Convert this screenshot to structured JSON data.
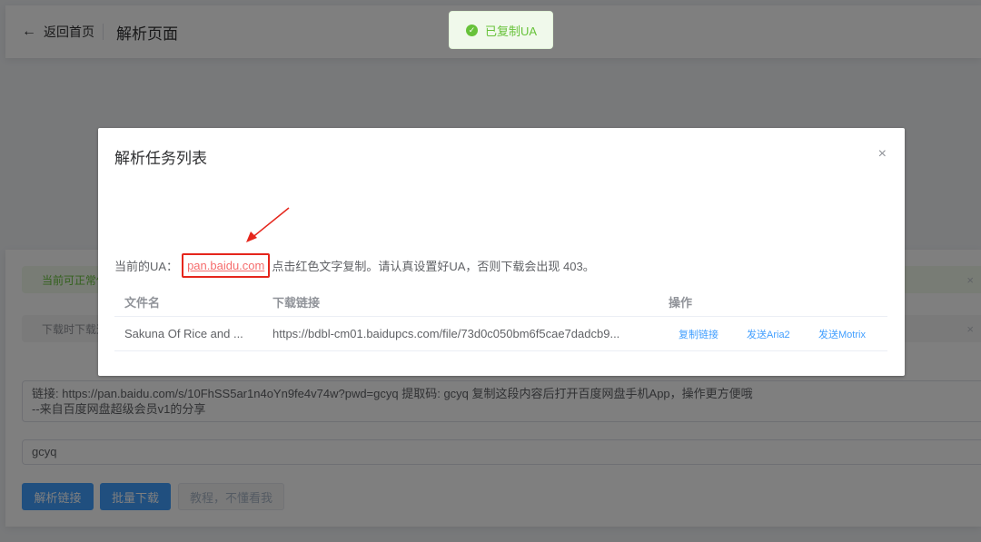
{
  "header": {
    "back_label": "返回首页",
    "title": "解析页面"
  },
  "alerts": {
    "success_text": "当前可正常使用",
    "info_text": "下载时下载速度",
    "close_glyph": "×"
  },
  "form": {
    "share_text": "链接: https://pan.baidu.com/s/10FhSS5ar1n4oYn9fe4v74w?pwd=gcyq 提取码: gcyq 复制这段内容后打开百度网盘手机App，操作更方便哦\n--来自百度网盘超级会员v1的分享",
    "code_value": "gcyq",
    "buttons": {
      "parse": "解析链接",
      "batch": "批量下载",
      "tutorial": "教程，不懂看我"
    }
  },
  "toast": {
    "text": "已复制UA",
    "icon": "check-circle-icon"
  },
  "dialog": {
    "title": "解析任务列表",
    "close_glyph": "×",
    "ua_prefix": "当前的UA：",
    "ua_value": "pan.baidu.com",
    "ua_suffix": "点击红色文字复制。请认真设置好UA，否则下载会出现 403。",
    "table": {
      "headers": [
        "文件名",
        "下载链接",
        "操作"
      ],
      "rows": [
        {
          "filename": "Sakuna Of Rice and ...",
          "url": "https://bdbl-cm01.baidupcs.com/file/73d0c050bm6f5cae7dadcb9...",
          "actions": [
            "复制链接",
            "发送Aria2",
            "发送Motrix"
          ]
        }
      ]
    }
  },
  "colors": {
    "primary": "#409eff",
    "danger": "#f56c6c",
    "success": "#67c23a",
    "highlight_box": "#e5261c"
  }
}
